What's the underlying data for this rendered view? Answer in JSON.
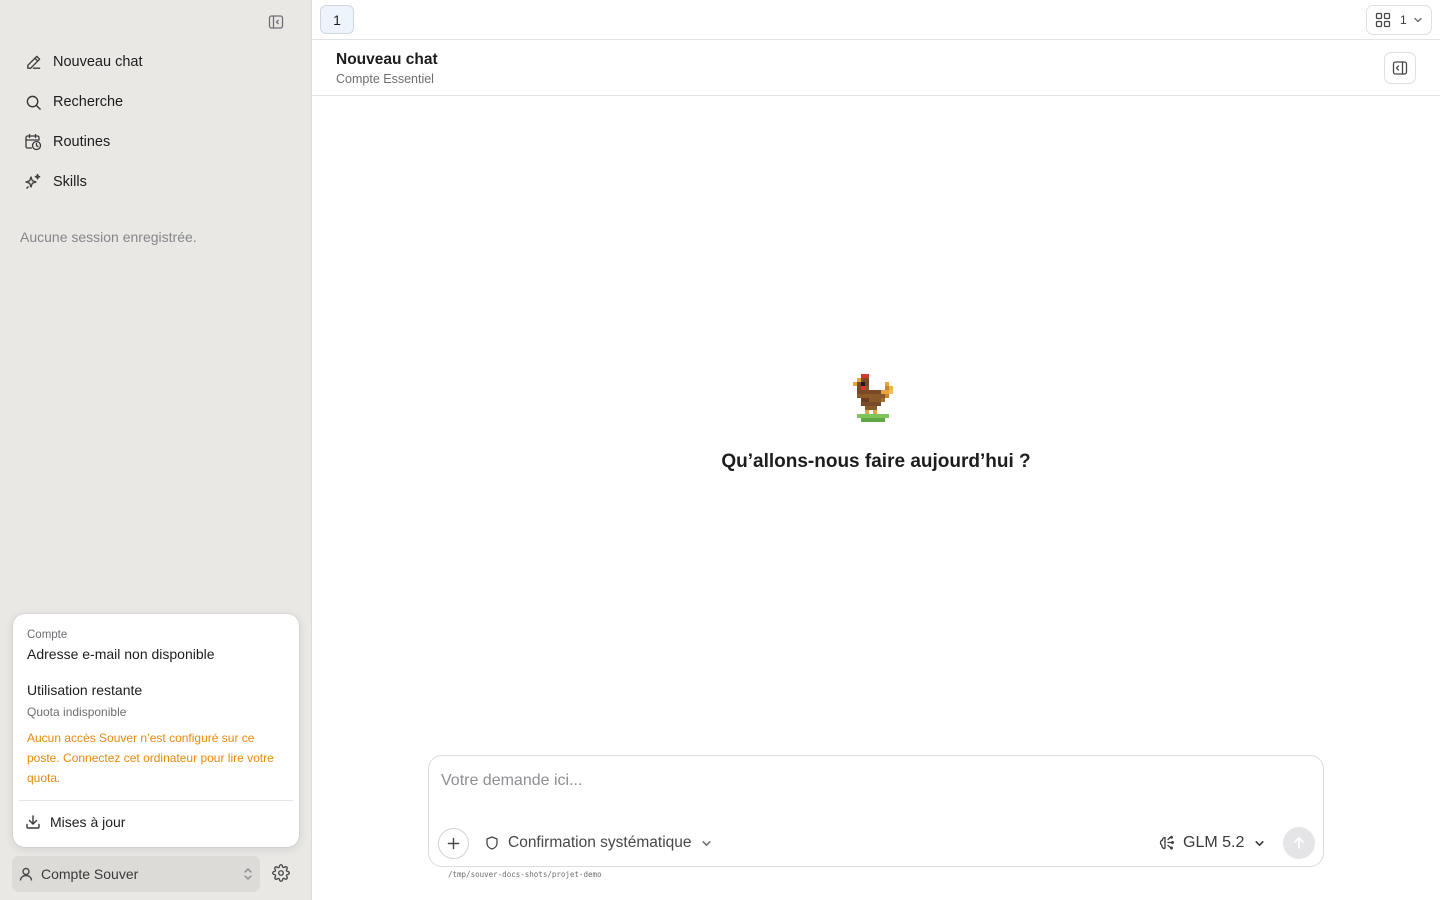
{
  "sidebar": {
    "nav": [
      {
        "label": "Nouveau chat",
        "icon": "pencil-icon"
      },
      {
        "label": "Recherche",
        "icon": "search-icon"
      },
      {
        "label": "Routines",
        "icon": "calendar-clock-icon"
      },
      {
        "label": "Skills",
        "icon": "sparkles-icon"
      }
    ],
    "empty_sessions": "Aucune session enregistrée."
  },
  "account_popover": {
    "section_label": "Compte",
    "email": "Adresse e-mail non disponible",
    "usage_title": "Utilisation restante",
    "quota": "Quota indisponible",
    "warning": "Aucun accès Souver n’est configuré sur ce poste. Connectez cet ordinateur pour lire votre quota.",
    "updates_label": "Mises à jour"
  },
  "account_bar": {
    "label": "Compte Souver"
  },
  "tabs": {
    "active_tab": "1",
    "layout_count": "1"
  },
  "chat_header": {
    "title": "Nouveau chat",
    "subtitle": "Compte Essentiel"
  },
  "welcome": {
    "title": "Qu’allons-nous faire aujourd’hui ?"
  },
  "composer": {
    "placeholder": "Votre demande ici...",
    "confirmation_mode": "Confirmation systématique",
    "model": "GLM 5.2",
    "cwd_path": "/tmp/souver-docs-shots/projet-demo"
  },
  "colors": {
    "sidebar_bg": "#e9e8e5",
    "warning": "#e8890c",
    "tab_active_bg": "#eef4fb"
  }
}
